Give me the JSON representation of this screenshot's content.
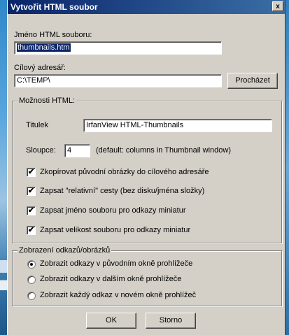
{
  "window": {
    "title": "Vytvořit HTML soubor",
    "close_glyph": "x"
  },
  "fields": {
    "filename_label": "Jméno HTML souboru:",
    "filename_value": "thumbnails.htm",
    "target_label": "Cílový adresář:",
    "target_value": "C:\\TEMP\\",
    "browse_button": "Procházet"
  },
  "html_options": {
    "group_label": "Možnosti HTML:",
    "title_label": "Titulek",
    "title_value": "IrfanView HTML-Thumbnails",
    "columns_label": "Sloupce:",
    "columns_value": "4",
    "columns_hint": "(default: columns in Thumbnail window)",
    "checkboxes": [
      {
        "label": "Zkopírovat původní obrázky do cílového adresáře",
        "checked": true
      },
      {
        "label": "Zapsat \"relativní\" cesty (bez disku/jména složky)",
        "checked": true
      },
      {
        "label": "Zapsat jméno souboru pro odkazy miniatur",
        "checked": true
      },
      {
        "label": "Zapsat velikost souboru pro odkazy miniatur",
        "checked": true
      }
    ]
  },
  "link_display": {
    "group_label": "Zobrazení odkazů/obrázků",
    "options": [
      {
        "label": "Zobrazit odkazy v původním okně prohlížeče",
        "selected": true
      },
      {
        "label": "Zobrazit odkazy v dalším okně prohlížeče",
        "selected": false
      },
      {
        "label": "Zobrazit každý odkaz v novém okně prohlížeč",
        "selected": false
      }
    ]
  },
  "buttons": {
    "ok": "OK",
    "cancel": "Storno"
  },
  "check_glyph": "✔"
}
